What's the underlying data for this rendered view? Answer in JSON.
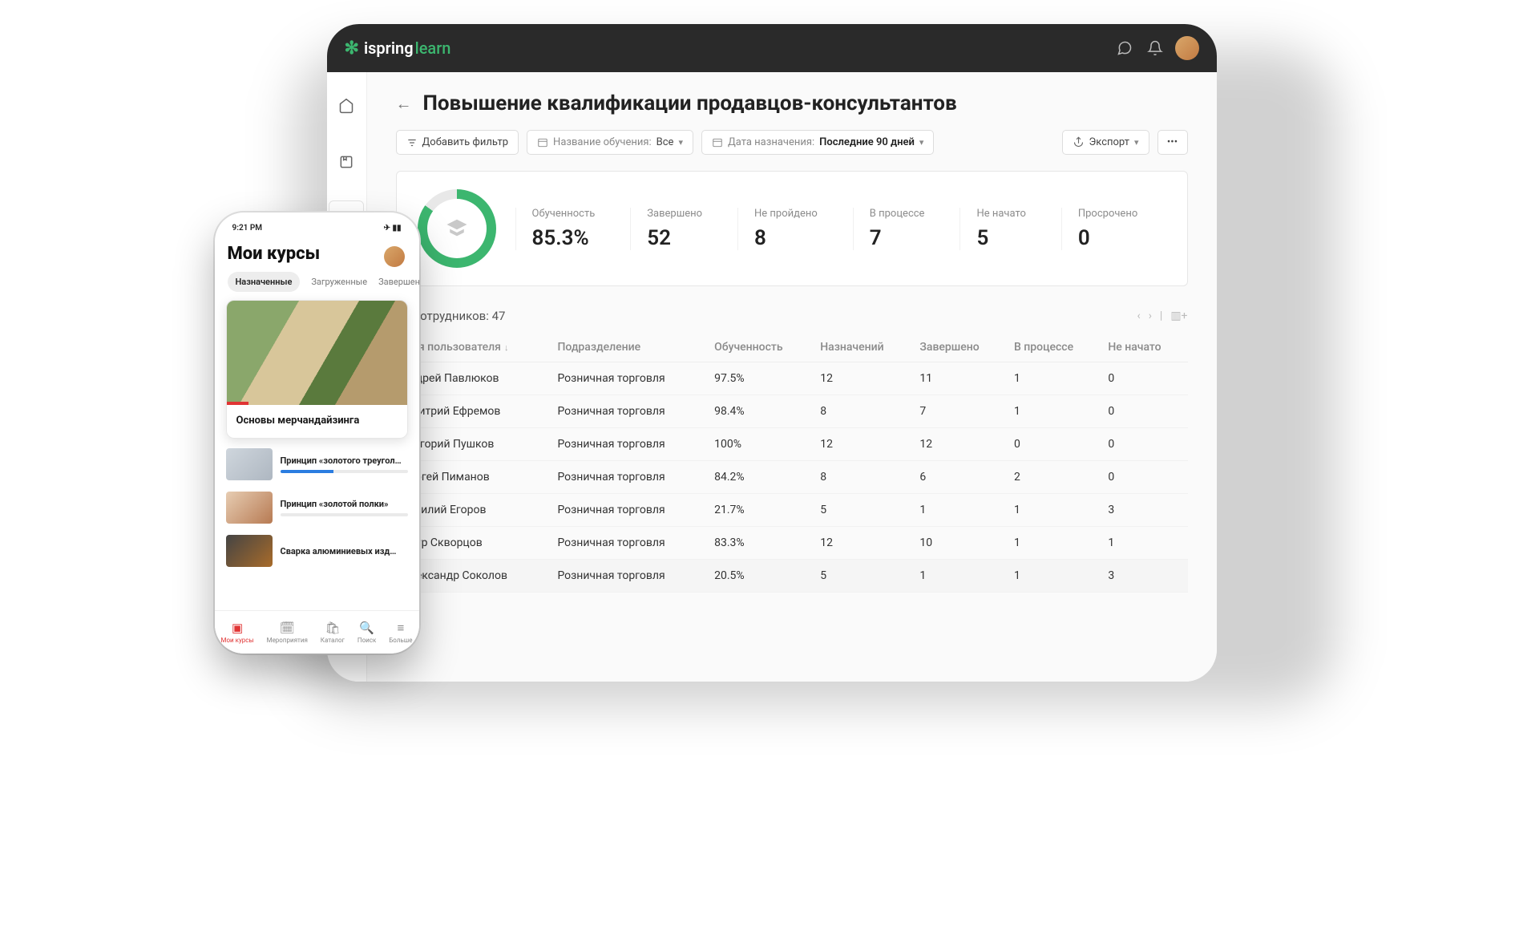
{
  "brand": {
    "name": "ispring",
    "suffix": "learn"
  },
  "page": {
    "title": "Повышение квалификации продавцов-консультантов",
    "add_filter": "Добавить фильтр",
    "filter_training_label": "Название обучения:",
    "filter_training_value": "Все",
    "filter_date_label": "Дата назначения:",
    "filter_date_value": "Последние 90 дней",
    "export": "Экспорт"
  },
  "kpi": {
    "obuchennost_label": "Обученность",
    "obuchennost_value": "85.3%",
    "zaversheno_label": "Завершено",
    "zaversheno_value": "52",
    "neproideno_label": "Не пройдено",
    "neproideno_value": "8",
    "vprocesse_label": "В процессе",
    "vprocesse_value": "7",
    "nenachato_label": "Не начато",
    "nenachato_value": "5",
    "prosrocheno_label": "Просрочено",
    "prosrocheno_value": "0"
  },
  "emp_section": {
    "prefix": "ых сотрудников:",
    "count": "47"
  },
  "columns": {
    "name": "Имя пользователя",
    "dept": "Подразделение",
    "ob": "Обученность",
    "assigned": "Назначений",
    "done": "Завершено",
    "inprog": "В процессе",
    "notstarted": "Не начато"
  },
  "rows": [
    {
      "name": "Андрей Павлюков",
      "dept": "Розничная торговля",
      "ob": "97.5%",
      "a": "12",
      "d": "11",
      "p": "1",
      "n": "0"
    },
    {
      "name": "Дмитрий Ефремов",
      "dept": "Розничная торговля",
      "ob": "98.4%",
      "a": "8",
      "d": "7",
      "p": "1",
      "n": "0"
    },
    {
      "name": "Григорий Пушков",
      "dept": "Розничная торговля",
      "ob": "100%",
      "a": "12",
      "d": "12",
      "p": "0",
      "n": "0"
    },
    {
      "name": "Сергей Пиманов",
      "dept": "Розничная торговля",
      "ob": "84.2%",
      "a": "8",
      "d": "6",
      "p": "2",
      "n": "0"
    },
    {
      "name": "Василий Егоров",
      "dept": "Розничная торговля",
      "ob": "21.7%",
      "a": "5",
      "d": "1",
      "p": "1",
      "n": "3"
    },
    {
      "name": "Пётр Скворцов",
      "dept": "Розничная торговля",
      "ob": "83.3%",
      "a": "12",
      "d": "10",
      "p": "1",
      "n": "1"
    },
    {
      "name": "Александр Соколов",
      "dept": "Розничная торговля",
      "ob": "20.5%",
      "a": "5",
      "d": "1",
      "p": "1",
      "n": "3"
    }
  ],
  "phone": {
    "time": "9:21 PM",
    "title": "Мои курсы",
    "tabs": {
      "t1": "Назначенные",
      "t2": "Загруженные",
      "t3": "Завершен"
    },
    "hero": "Основы мерчандайзинга",
    "item1": "Принцип «золотого треугол…",
    "item2": "Принцип «золотой полки»",
    "item3": "Сварка алюминиевых изд…",
    "nav": {
      "n1": "Мои курсы",
      "n2": "Мероприятия",
      "n3": "Каталог",
      "n4": "Поиск",
      "n5": "Больше"
    }
  }
}
